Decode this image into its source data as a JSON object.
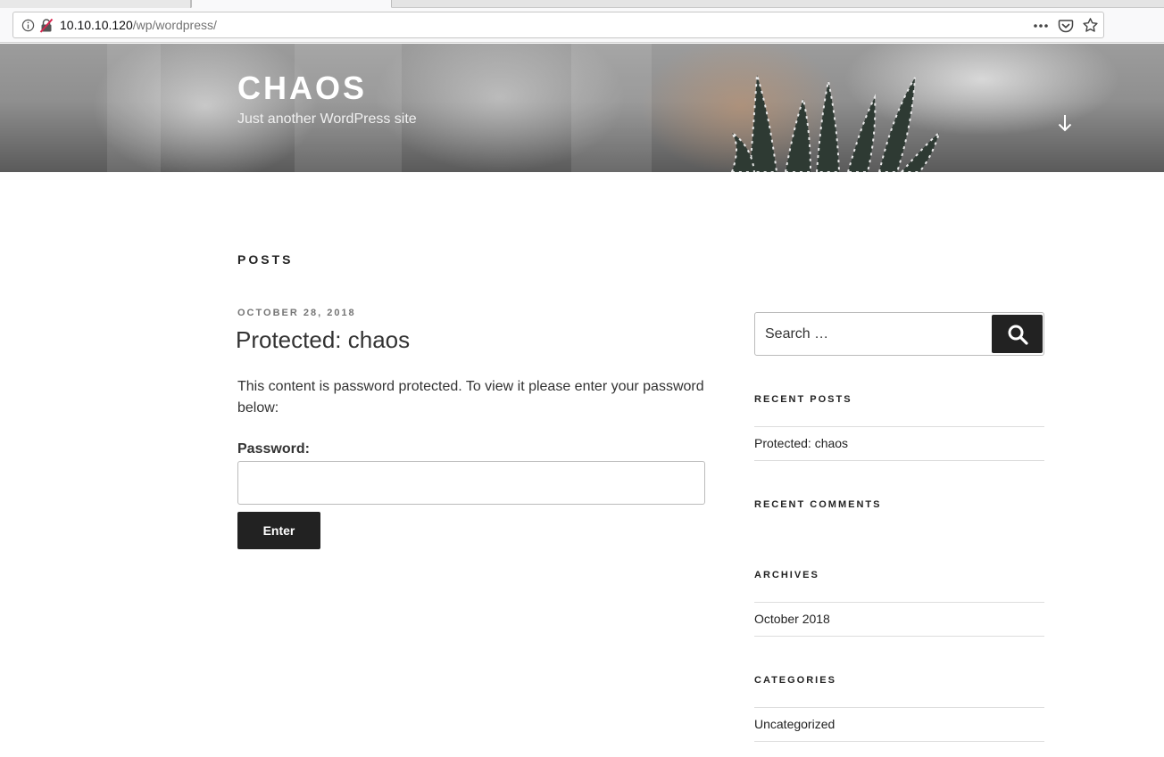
{
  "browser": {
    "url_host": "10.10.10.120",
    "url_path": "/wp/wordpress/"
  },
  "site": {
    "title": "CHAOS",
    "description": "Just another WordPress site"
  },
  "content": {
    "heading": "POSTS",
    "post": {
      "date": "OCTOBER 28, 2018",
      "title": "Protected: chaos",
      "message": "This content is password protected. To view it please enter your password below:",
      "password_label": "Password:",
      "password_value": "",
      "submit_label": "Enter"
    }
  },
  "sidebar": {
    "search": {
      "placeholder": "Search …"
    },
    "recent_posts": {
      "title": "RECENT POSTS",
      "items": [
        "Protected: chaos"
      ]
    },
    "recent_comments": {
      "title": "RECENT COMMENTS"
    },
    "archives": {
      "title": "ARCHIVES",
      "items": [
        "October 2018"
      ]
    },
    "categories": {
      "title": "CATEGORIES",
      "items": [
        "Uncategorized"
      ]
    }
  },
  "colors": {
    "accent_dark": "#222222",
    "header_text": "#ffffff",
    "meta_gray": "#767676"
  },
  "icons": [
    "info-icon",
    "insecure-lock-icon",
    "more-icon",
    "pocket-icon",
    "bookmark-star-icon",
    "scroll-down-arrow-icon",
    "search-icon"
  ]
}
